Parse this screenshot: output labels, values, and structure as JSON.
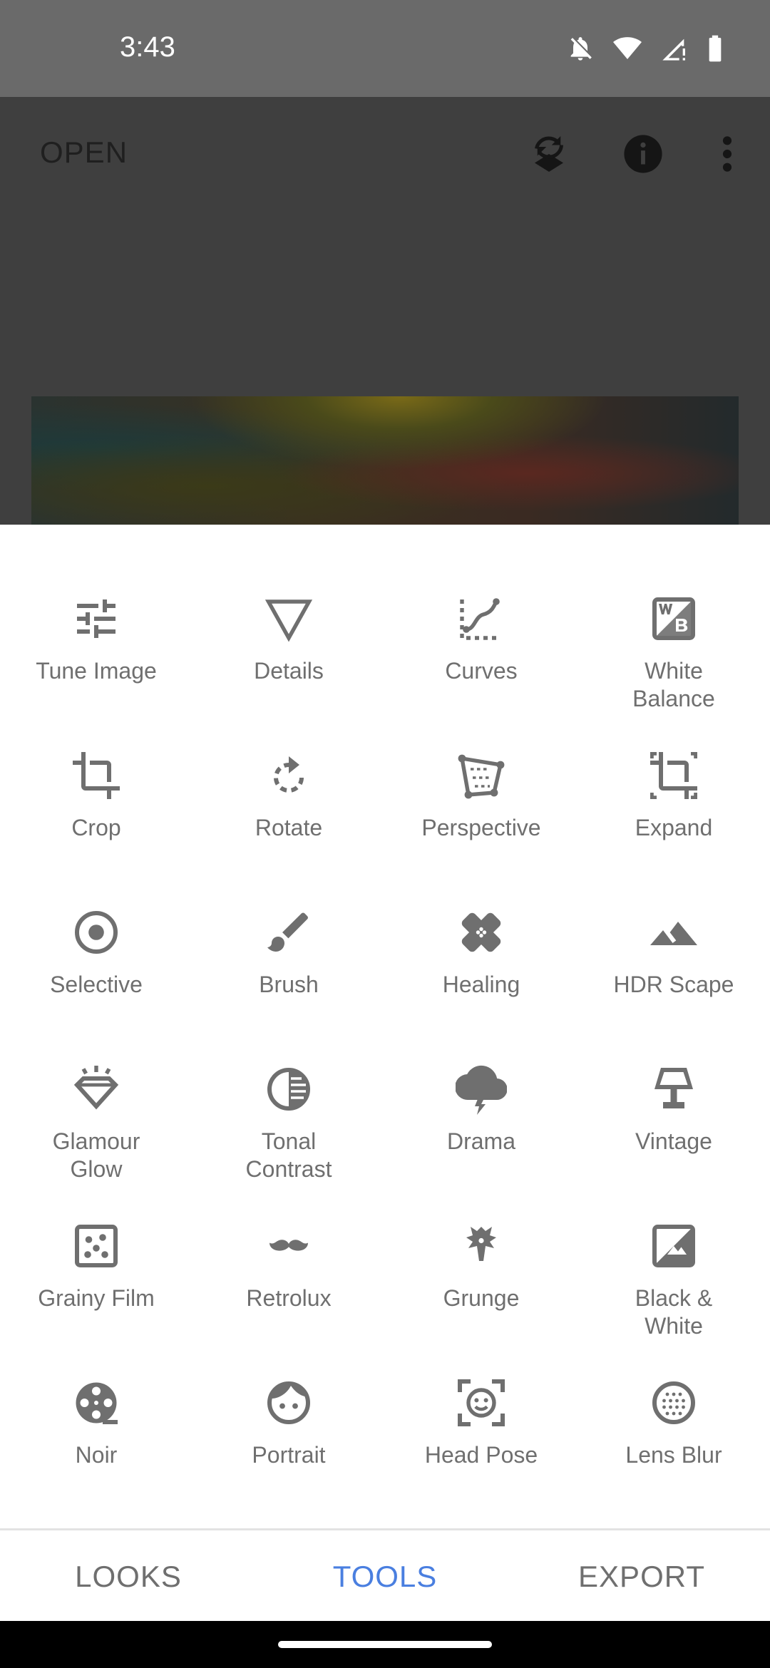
{
  "status_bar": {
    "time": "3:43"
  },
  "top_bar": {
    "open_label": "OPEN"
  },
  "tools": [
    {
      "label": "Tune Image",
      "icon": "tune-icon"
    },
    {
      "label": "Details",
      "icon": "triangle-icon"
    },
    {
      "label": "Curves",
      "icon": "curves-icon"
    },
    {
      "label": "White\nBalance",
      "icon": "white-balance-icon"
    },
    {
      "label": "Crop",
      "icon": "crop-icon"
    },
    {
      "label": "Rotate",
      "icon": "rotate-icon"
    },
    {
      "label": "Perspective",
      "icon": "perspective-icon"
    },
    {
      "label": "Expand",
      "icon": "expand-icon"
    },
    {
      "label": "Selective",
      "icon": "selective-icon"
    },
    {
      "label": "Brush",
      "icon": "brush-icon"
    },
    {
      "label": "Healing",
      "icon": "bandage-icon"
    },
    {
      "label": "HDR Scape",
      "icon": "mountain-icon"
    },
    {
      "label": "Glamour\nGlow",
      "icon": "diamond-icon"
    },
    {
      "label": "Tonal\nContrast",
      "icon": "tonal-contrast-icon"
    },
    {
      "label": "Drama",
      "icon": "cloud-lightning-icon"
    },
    {
      "label": "Vintage",
      "icon": "lamp-icon"
    },
    {
      "label": "Grainy Film",
      "icon": "grain-icon"
    },
    {
      "label": "Retrolux",
      "icon": "mustache-icon"
    },
    {
      "label": "Grunge",
      "icon": "guitar-icon"
    },
    {
      "label": "Black &\nWhite",
      "icon": "bw-icon"
    },
    {
      "label": "Noir",
      "icon": "film-reel-icon"
    },
    {
      "label": "Portrait",
      "icon": "face-icon"
    },
    {
      "label": "Head Pose",
      "icon": "face-frame-icon"
    },
    {
      "label": "Lens Blur",
      "icon": "lens-blur-icon"
    }
  ],
  "bottom_nav": {
    "looks": "LOOKS",
    "tools": "TOOLS",
    "export": "EXPORT"
  },
  "colors": {
    "accent": "#4a7fe0",
    "icon": "#6f6f6f",
    "label": "#6f6f6f",
    "overlay": "#3f3f3f"
  }
}
